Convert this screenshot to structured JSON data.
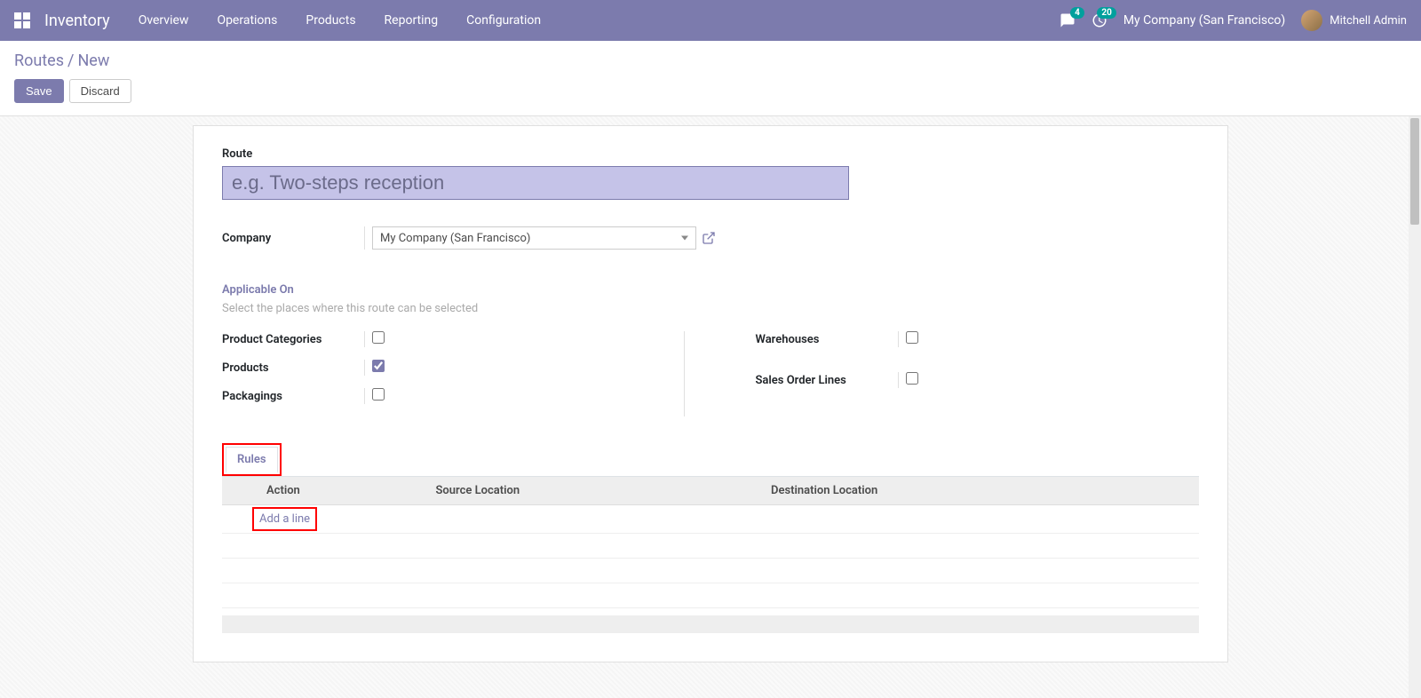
{
  "navbar": {
    "app_title": "Inventory",
    "menu": [
      "Overview",
      "Operations",
      "Products",
      "Reporting",
      "Configuration"
    ],
    "messages_badge": "4",
    "activities_badge": "20",
    "company": "My Company (San Francisco)",
    "user": "Mitchell Admin"
  },
  "breadcrumb": {
    "parent": "Routes",
    "current": "New"
  },
  "buttons": {
    "save": "Save",
    "discard": "Discard"
  },
  "form": {
    "route_label": "Route",
    "route_placeholder": "e.g. Two-steps reception",
    "route_value": "",
    "company_label": "Company",
    "company_value": "My Company (San Francisco)",
    "applicable_title": "Applicable On",
    "applicable_hint": "Select the places where this route can be selected",
    "fields": {
      "product_categories": {
        "label": "Product Categories",
        "checked": false
      },
      "products": {
        "label": "Products",
        "checked": true
      },
      "packagings": {
        "label": "Packagings",
        "checked": false
      },
      "warehouses": {
        "label": "Warehouses",
        "checked": false
      },
      "sales_order_lines": {
        "label": "Sales Order Lines",
        "checked": false
      }
    }
  },
  "tabs": {
    "rules": "Rules"
  },
  "table": {
    "headers": {
      "action": "Action",
      "source": "Source Location",
      "destination": "Destination Location"
    },
    "add_line": "Add a line"
  }
}
